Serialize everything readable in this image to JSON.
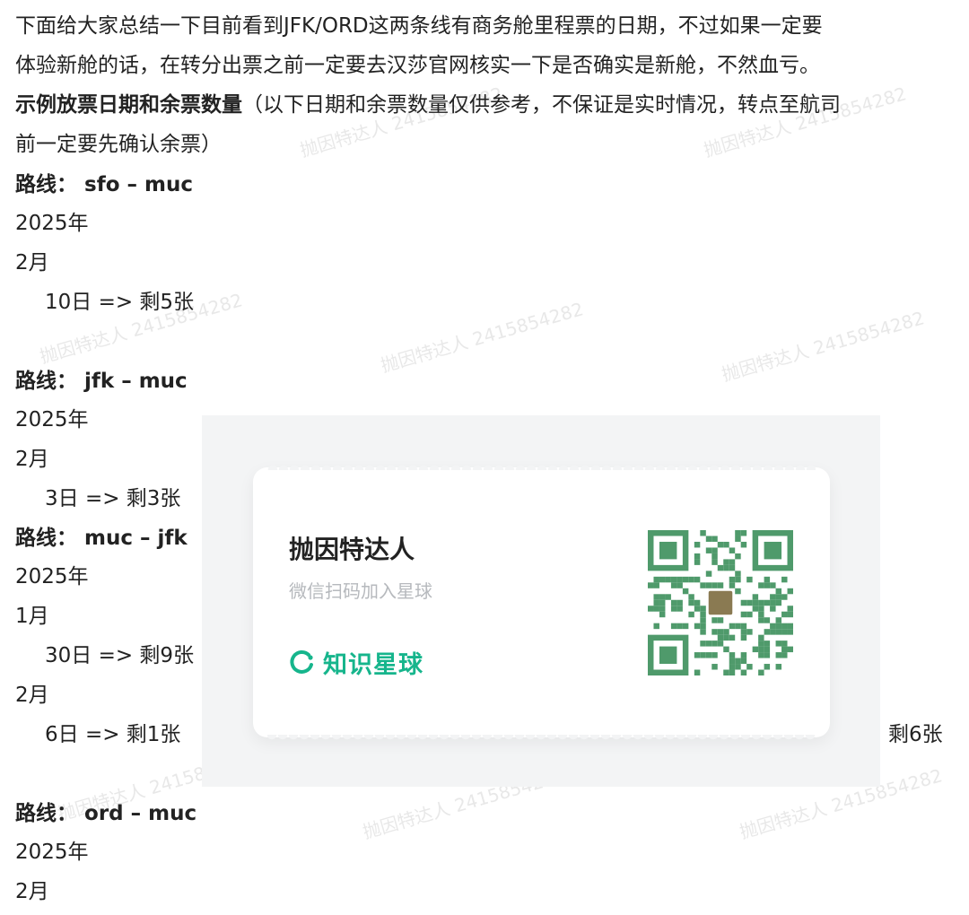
{
  "intro": [
    "下面给大家总结一下目前看到JFK/ORD这两条线有商务舱里程票的日期，不过如果一定要",
    "体验新舱的话，在转分出票之前一定要去汉莎官网核实一下是否确实是新舱，不然血亏。"
  ],
  "example_heading": "示例放票日期和余票数量",
  "example_note_line1": "（以下日期和余票数量仅供参考，不保证是实时情况，转点至航司",
  "example_note_line2": "前一定要先确认余票）",
  "route_label": "路线：",
  "routes": {
    "r1": {
      "name": "sfo – muc",
      "year": "2025年",
      "month": "2月",
      "day": "10日 => 剩5张"
    },
    "r2": {
      "name": "jfk – muc",
      "year": "2025年",
      "month": "2月",
      "day": "3日 => 剩3张"
    },
    "r3": {
      "name": "muc – jfk",
      "year": "2025年",
      "month1": "1月",
      "day1": "30日 => 剩9张",
      "month2": "2月",
      "day2": "6日 => 剩1张",
      "tail": "剩6张"
    },
    "r4": {
      "name": "ord – muc",
      "year": "2025年",
      "month": "2月"
    }
  },
  "card": {
    "title": "抛因特达人",
    "subtitle": "微信扫码加入星球",
    "brand": "知识星球",
    "brand_color": "#16b58c",
    "qr_color": "#4f9a6b"
  },
  "watermark": "抛因特达人 2415854282"
}
